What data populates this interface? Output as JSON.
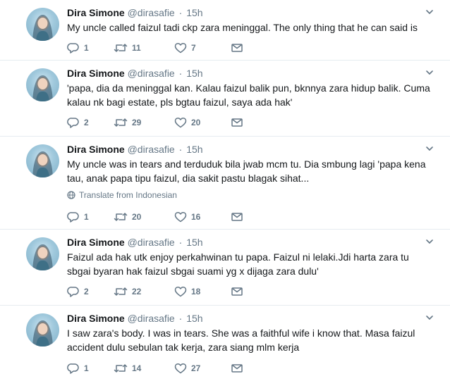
{
  "colors": {
    "secondary_text": "#657786",
    "primary_text": "#14171a",
    "divider": "#e6ecf0"
  },
  "icons": {
    "reply": "reply-icon",
    "retweet": "retweet-icon",
    "like": "heart-icon",
    "message": "envelope-icon",
    "more": "chevron-down-icon",
    "translate": "globe-icon"
  },
  "tweets": [
    {
      "name": "Dira Simone",
      "handle": "@dirasafie",
      "separator": "·",
      "time": "15h",
      "text": "My uncle called faizul tadi ckp zara meninggal. The only thing that he can said is",
      "replies": "1",
      "retweets": "11",
      "likes": "7"
    },
    {
      "name": "Dira Simone",
      "handle": "@dirasafie",
      "separator": "·",
      "time": "15h",
      "text": "'papa, dia da meninggal kan. Kalau faizul balik pun, bknnya zara hidup balik. Cuma kalau nk bagi estate, pls bgtau faizul, saya ada hak'",
      "replies": "2",
      "retweets": "29",
      "likes": "20"
    },
    {
      "name": "Dira Simone",
      "handle": "@dirasafie",
      "separator": "·",
      "time": "15h",
      "text": "My uncle was in tears and terduduk bila jwab mcm tu. Dia smbung lagi 'papa kena tau, anak papa tipu faizul, dia sakit pastu blagak sihat...",
      "translate": "Translate from Indonesian",
      "replies": "1",
      "retweets": "20",
      "likes": "16"
    },
    {
      "name": "Dira Simone",
      "handle": "@dirasafie",
      "separator": "·",
      "time": "15h",
      "text": "Faizul ada hak utk enjoy perkahwinan tu papa. Faizul ni lelaki.Jdi harta zara tu sbgai byaran hak faizul sbgai suami yg x dijaga zara dulu'",
      "replies": "2",
      "retweets": "22",
      "likes": "18"
    },
    {
      "name": "Dira Simone",
      "handle": "@dirasafie",
      "separator": "·",
      "time": "15h",
      "text": "I saw zara's body. I was in tears. She was a faithful wife i know that. Masa faizul accident dulu sebulan tak kerja, zara siang mlm kerja",
      "replies": "1",
      "retweets": "14",
      "likes": "27"
    }
  ]
}
